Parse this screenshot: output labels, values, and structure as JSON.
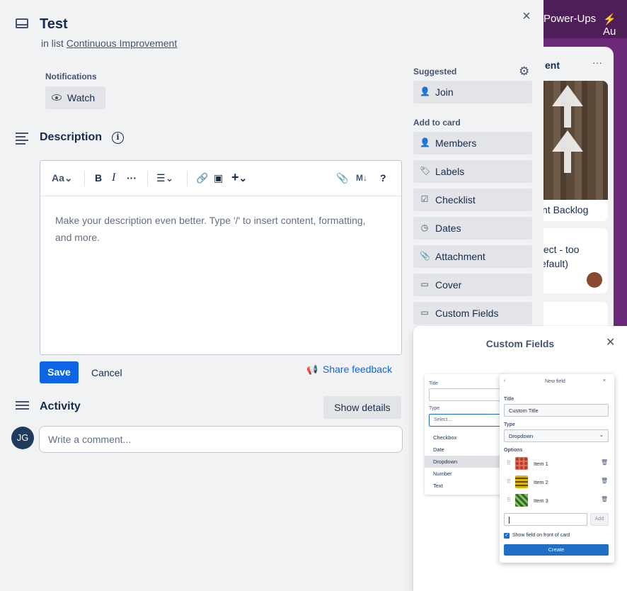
{
  "board": {
    "power_ups": "Power-Ups",
    "automation": "Au",
    "list_title": "ent",
    "list_menu": "···",
    "card1_caption": "nt Backlog",
    "card2_text_line1": "fect - too",
    "card2_text_line2": "efault)"
  },
  "card": {
    "title": "Test",
    "in_list_prefix": "in list",
    "list_name": "Continuous Improvement",
    "close_icon": "×"
  },
  "notifications": {
    "label": "Notifications",
    "watch_label": "Watch"
  },
  "description": {
    "title": "Description",
    "info_icon": "i",
    "placeholder": "Make your description even better. Type '/' to insert content, formatting, and more.",
    "toolbar": {
      "text_style": "Aa",
      "bold": "B",
      "italic": "I",
      "more": "···",
      "list": "☰",
      "link": "🔗",
      "image": "▣",
      "insert": "+",
      "attach": "📎",
      "markdown": "M↓",
      "help": "?"
    },
    "save_label": "Save",
    "cancel_label": "Cancel",
    "feedback_label": "Share feedback"
  },
  "activity": {
    "title": "Activity",
    "show_details_label": "Show details",
    "avatar_initials": "JG",
    "comment_placeholder": "Write a comment..."
  },
  "sidebar": {
    "suggested_label": "Suggested",
    "join_label": "Join",
    "add_to_card_label": "Add to card",
    "items": [
      {
        "label": "Members",
        "icon": "person-icon"
      },
      {
        "label": "Labels",
        "icon": "tag-icon"
      },
      {
        "label": "Checklist",
        "icon": "checkbox-icon"
      },
      {
        "label": "Dates",
        "icon": "clock-icon"
      },
      {
        "label": "Attachment",
        "icon": "paperclip-icon"
      },
      {
        "label": "Cover",
        "icon": "cover-icon"
      },
      {
        "label": "Custom Fields",
        "icon": "custom-fields-icon"
      }
    ]
  },
  "popover": {
    "title": "Custom Fields",
    "back_card": {
      "title_label": "Title",
      "type_label": "Type",
      "select_placeholder": "Select...",
      "options": [
        "Checkbox",
        "Date",
        "Dropdown",
        "Number",
        "Text"
      ]
    },
    "front_card": {
      "header": "New field",
      "title_label": "Title",
      "title_value": "Custom Title",
      "type_label": "Type",
      "type_value": "Dropdown",
      "options_label": "Options",
      "items": [
        "Item 1",
        "Item 2",
        "Item 3"
      ],
      "add_label": "Add",
      "show_on_front": "Show field on front of card",
      "create_label": "Create"
    }
  },
  "colors": {
    "primary": "#0c66e4",
    "board_bg": "#6b2a78",
    "modal_bg": "#f1f2f4"
  }
}
